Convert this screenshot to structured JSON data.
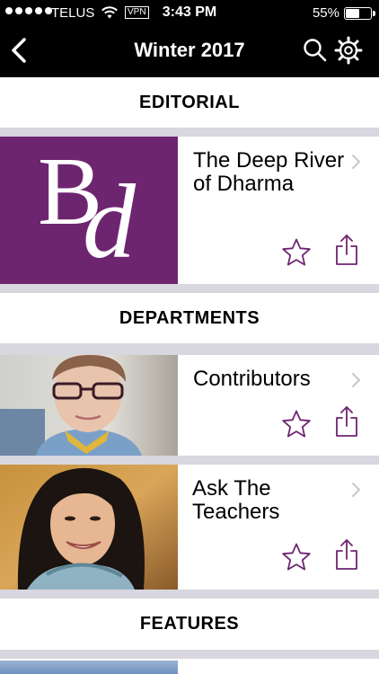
{
  "status": {
    "carrier": "TELUS",
    "vpn": "VPN",
    "time": "3:43 PM",
    "battery": "55%",
    "battery_level": 0.55
  },
  "nav": {
    "title": "Winter 2017",
    "back_icon": "chevron-left-icon",
    "search_icon": "search-icon",
    "settings_icon": "gear-icon"
  },
  "sections": [
    {
      "label": "EDITORIAL",
      "articles": [
        {
          "title": "The Deep River of Dharma",
          "thumb": "bd-logo"
        }
      ]
    },
    {
      "label": "DEPARTMENTS",
      "articles": [
        {
          "title": "Contributors",
          "thumb": "photo-woman-glasses"
        },
        {
          "title": "Ask The Teachers",
          "thumb": "photo-woman-smiling"
        }
      ]
    },
    {
      "label": "FEATURES",
      "articles": []
    }
  ],
  "logo_text": {
    "b": "B",
    "d": "d"
  },
  "colors": {
    "accent": "#6e2570",
    "bar": "#000000",
    "divider": "#d8d6de"
  }
}
